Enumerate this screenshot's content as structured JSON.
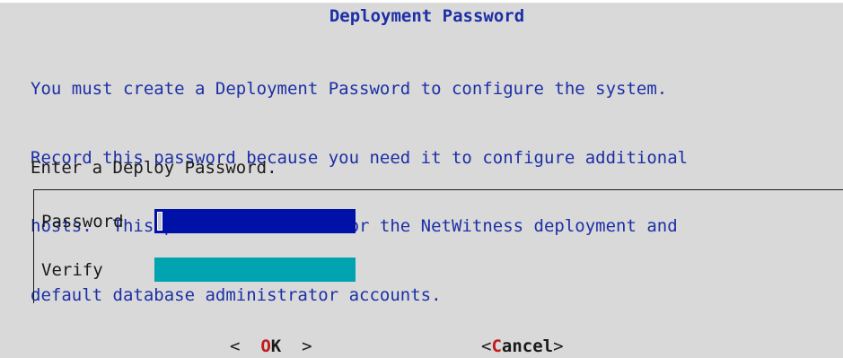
{
  "dialog": {
    "title": "Deployment Password",
    "message_lines": [
      "You must create a Deployment Password to configure the system.",
      "Record this password because you need it to configure additional",
      "hosts.  This password is used for the NetWitness deployment and",
      "default database administrator accounts."
    ],
    "prompt": "Enter a Deploy Password."
  },
  "form": {
    "password_label": "Password",
    "password_value": "",
    "verify_label": "Verify",
    "verify_value": "",
    "password_field_color": "#0011a8",
    "verify_field_color": "#00a3b0"
  },
  "buttons": {
    "ok": {
      "left": "<  ",
      "hotkey": "O",
      "rest": "K",
      "right": "  >"
    },
    "cancel": {
      "left": "<",
      "hotkey": "C",
      "rest": "ancel",
      "right": ">"
    }
  },
  "colors": {
    "background": "#d9d9d9",
    "title_text": "#1c2fa6",
    "message_text": "#1c2fa6",
    "hotkey": "#c01d1d"
  }
}
